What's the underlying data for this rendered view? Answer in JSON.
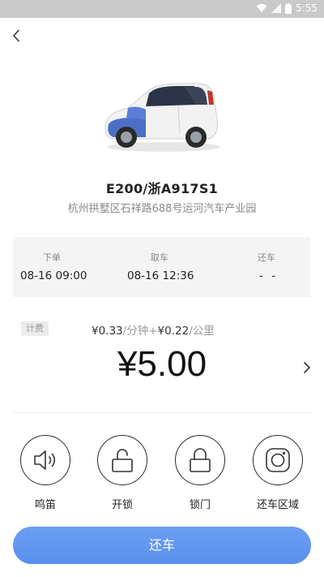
{
  "status_bar": {
    "time": "5:55",
    "icons": [
      "wifi-icon",
      "signal-icon",
      "battery-icon"
    ]
  },
  "nav": {
    "back_icon": "chevron-left-icon"
  },
  "vehicle": {
    "plate": "E200/浙A917S1",
    "address": "杭州拱墅区石祥路688号运河汽车产业园"
  },
  "timeline": [
    {
      "label": "下单",
      "value": "08-16 09:00"
    },
    {
      "label": "取车",
      "value": "08-16 12:36"
    },
    {
      "label": "还车",
      "value": "- -"
    }
  ],
  "fee": {
    "tag": "计费",
    "time_rate": "¥0.33",
    "time_unit": "/分钟+",
    "distance_rate": "¥0.22",
    "distance_unit": "/公里",
    "total": "¥5.00"
  },
  "actions": [
    {
      "label": "鸣笛",
      "icon": "horn-speaker-icon"
    },
    {
      "label": "开锁",
      "icon": "unlock-icon"
    },
    {
      "label": "锁门",
      "icon": "lock-icon"
    },
    {
      "label": "还车区域",
      "icon": "return-area-icon"
    }
  ],
  "primary_button": {
    "label": "还车"
  },
  "colors": {
    "accent": "#5e93ef",
    "status_bar": "#c9c9c9",
    "panel": "#f4f4f4",
    "muted_text": "#8a8a8a"
  }
}
